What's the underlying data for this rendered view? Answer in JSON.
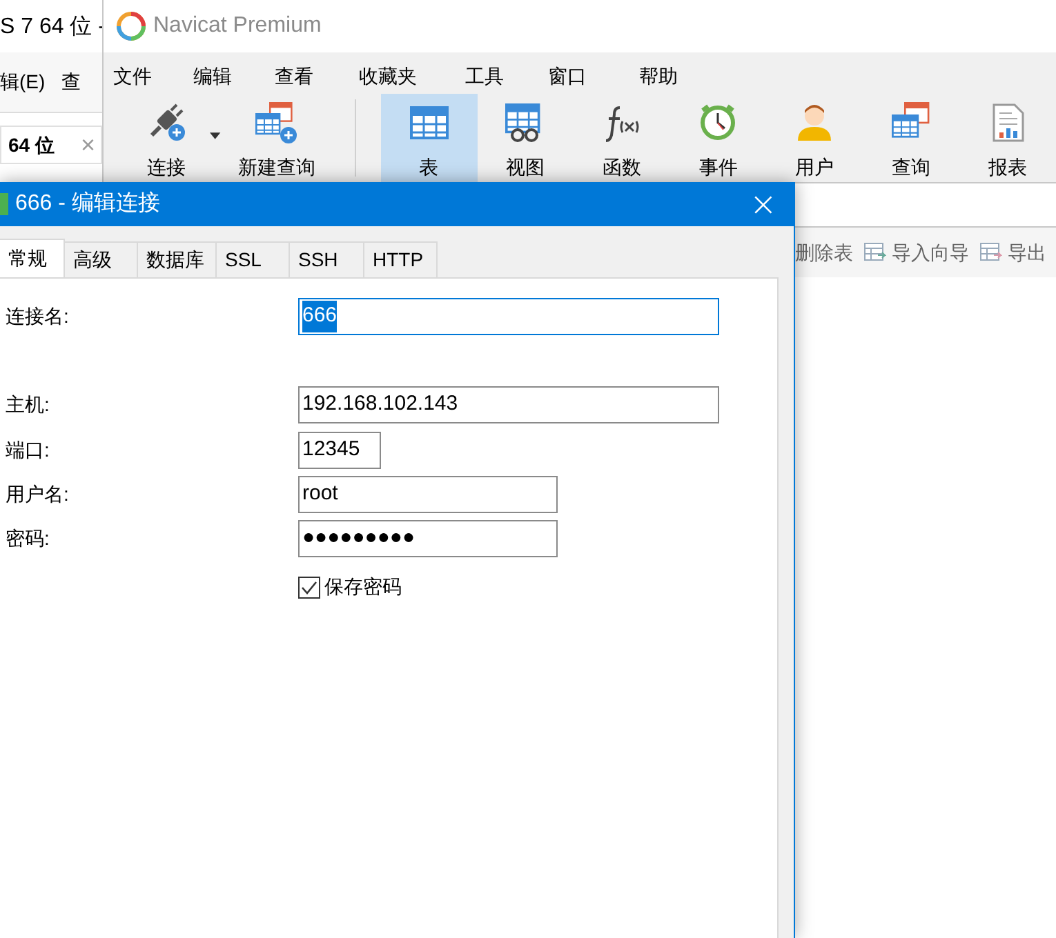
{
  "background_window": {
    "title": "S 7 64 位 -",
    "menu": [
      "辑(E)",
      "查"
    ],
    "tab": {
      "label": "64 位",
      "close": "×"
    }
  },
  "navicat": {
    "title": "Navicat Premium",
    "menu": [
      "文件",
      "编辑",
      "查看",
      "收藏夹",
      "工具",
      "窗口",
      "帮助"
    ],
    "toolbar": [
      {
        "label": "连接",
        "selected": false,
        "dropdown": true
      },
      {
        "label": "新建查询",
        "selected": false,
        "dropdown": false
      },
      {
        "label": "表",
        "selected": true,
        "dropdown": false
      },
      {
        "label": "视图",
        "selected": false,
        "dropdown": false
      },
      {
        "label": "函数",
        "selected": false,
        "dropdown": false
      },
      {
        "label": "事件",
        "selected": false,
        "dropdown": false
      },
      {
        "label": "用户",
        "selected": false,
        "dropdown": false
      },
      {
        "label": "查询",
        "selected": false,
        "dropdown": false
      },
      {
        "label": "报表",
        "selected": false,
        "dropdown": false
      }
    ],
    "object_toolbar": [
      "删除表",
      "导入向导",
      "导出"
    ]
  },
  "dialog": {
    "title": "666 - 编辑连接",
    "close": "×",
    "tabs": [
      {
        "label": "常规",
        "selected": true
      },
      {
        "label": "高级",
        "selected": false
      },
      {
        "label": "数据库",
        "selected": false
      },
      {
        "label": "SSL",
        "selected": false
      },
      {
        "label": "SSH",
        "selected": false
      },
      {
        "label": "HTTP",
        "selected": false
      }
    ],
    "fields": [
      {
        "label": "连接名:",
        "value": "666",
        "focused": true
      },
      {
        "label": "主机:",
        "value": "192.168.102.143",
        "focused": false
      },
      {
        "label": "端口:",
        "value": "12345",
        "focused": false
      },
      {
        "label": "用户名:",
        "value": "root",
        "focused": false
      },
      {
        "label": "密码:",
        "value": "●●●●●●●●●",
        "focused": false
      }
    ],
    "save_password": {
      "label": "保存密码",
      "checked": true
    }
  }
}
